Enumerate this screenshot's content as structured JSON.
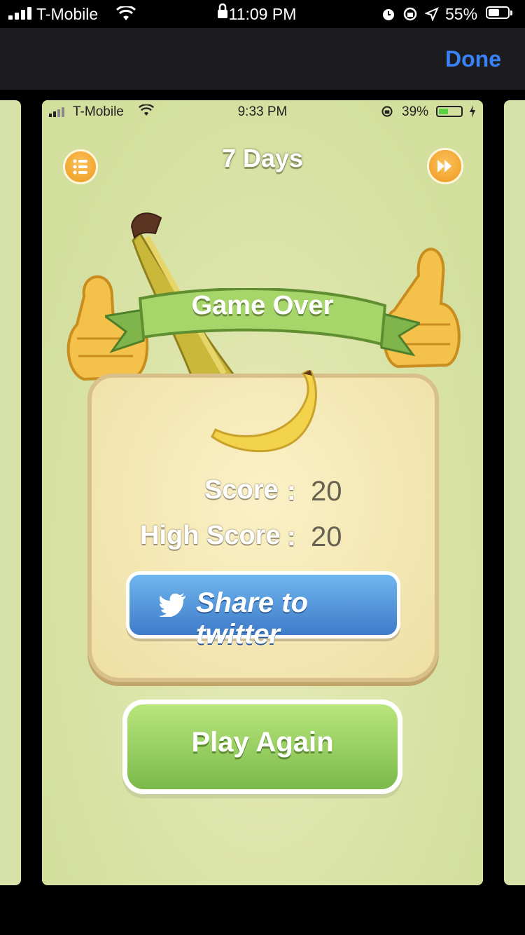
{
  "outer_status": {
    "carrier": "T-Mobile",
    "time": "11:09 PM",
    "battery": "55%"
  },
  "nav": {
    "done_label": "Done"
  },
  "inner_status": {
    "carrier": "T-Mobile",
    "time": "9:33 PM",
    "battery": "39%"
  },
  "game": {
    "title": "7 Days",
    "banner": "Game Over",
    "score_label": "Score",
    "score": "20",
    "high_score_label": "High Score",
    "high_score": "20",
    "separator": ":",
    "share_label": "Share to twitter",
    "play_again_label": "Play Again"
  },
  "colors": {
    "accent_blue": "#3a82f7",
    "twitter_blue": "#4a90d9",
    "play_green": "#8cc85a",
    "background_green": "#dde6ad"
  }
}
